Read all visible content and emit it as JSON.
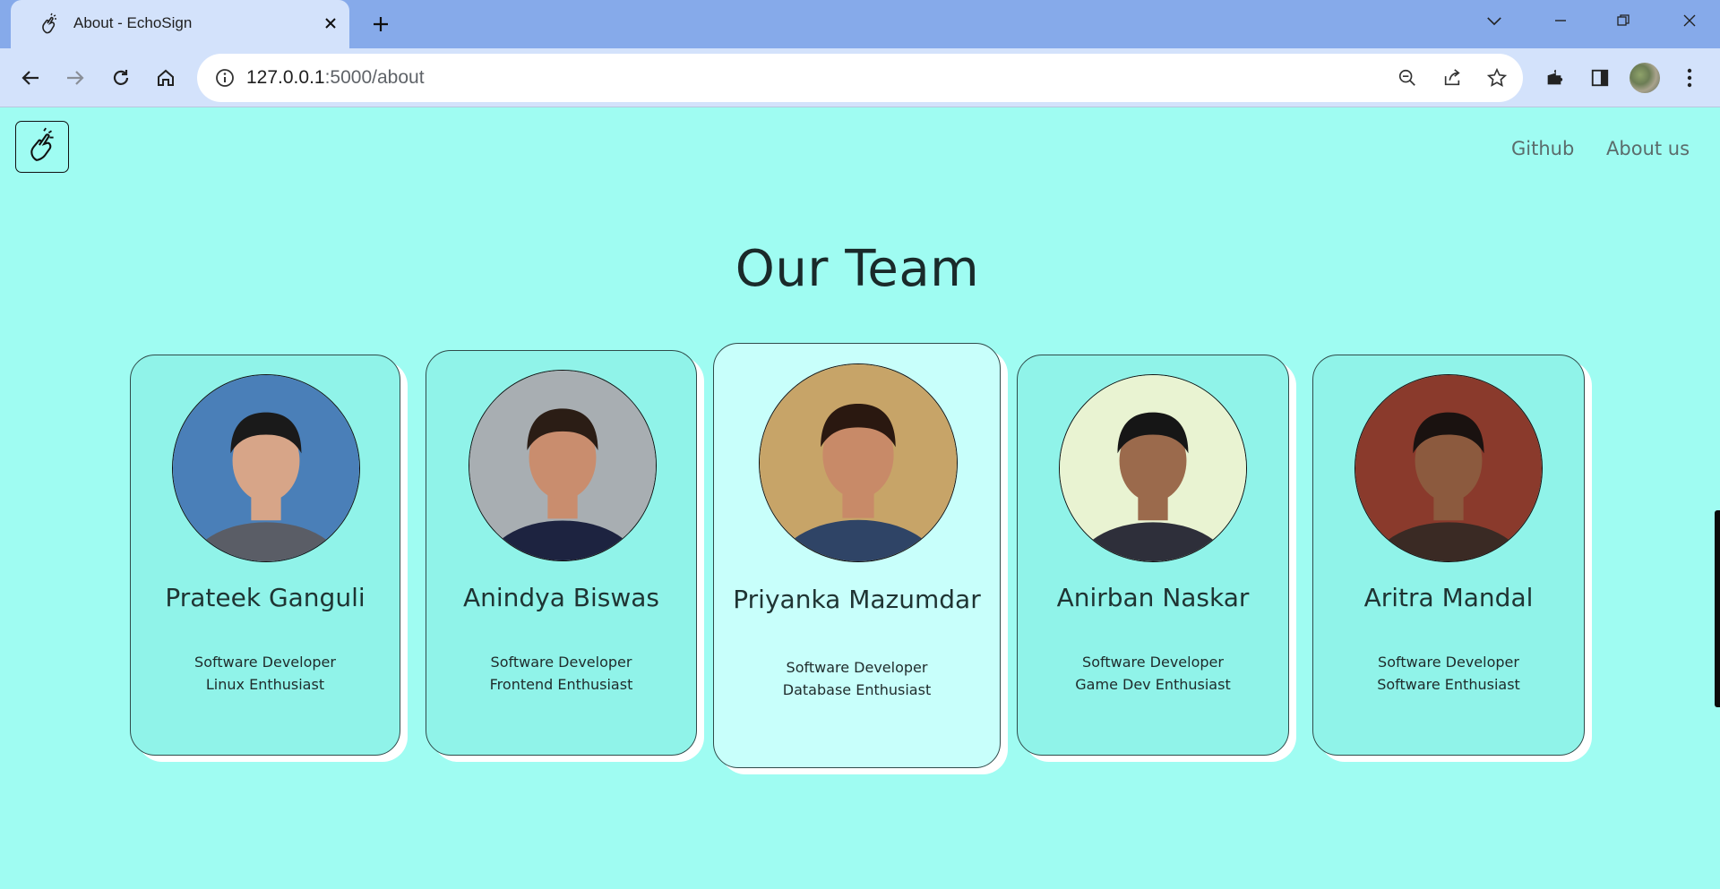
{
  "browser": {
    "tab_title": "About - EchoSign",
    "url_host": "127.0.0.1",
    "url_path": ":5000/about"
  },
  "nav": {
    "links": [
      {
        "label": "Github"
      },
      {
        "label": "About us"
      }
    ]
  },
  "page": {
    "title": "Our Team"
  },
  "team": [
    {
      "name": "Prateek Ganguli",
      "role_line1": "Software Developer",
      "role_line2": "Linux Enthusiast",
      "bg": "#4a7fb8",
      "skin": "#d7a588",
      "hair": "#1a1a1a",
      "shirt": "#5a5d66"
    },
    {
      "name": "Anindya Biswas",
      "role_line1": "Software Developer",
      "role_line2": "Frontend Enthusiast",
      "bg": "#a8aeb2",
      "skin": "#c98d6e",
      "hair": "#2b1d15",
      "shirt": "#1d2340"
    },
    {
      "name": "Priyanka Mazumdar",
      "role_line1": "Software Developer",
      "role_line2": "Database Enthusiast",
      "bg": "#c7a468",
      "skin": "#c88a68",
      "hair": "#2a1810",
      "shirt": "#2f4466"
    },
    {
      "name": "Anirban Naskar",
      "role_line1": "Software Developer",
      "role_line2": "Game Dev Enthusiast",
      "bg": "#e9f3d2",
      "skin": "#9b6a4c",
      "hair": "#161616",
      "shirt": "#2e2f3a"
    },
    {
      "name": "Aritra Mandal",
      "role_line1": "Software Developer",
      "role_line2": "Software Enthusiast",
      "bg": "#8a3a2c",
      "skin": "#8c5a3e",
      "hair": "#1a1210",
      "shirt": "#3a2a24"
    }
  ],
  "colors": {
    "page_bg": "#9ffcf2",
    "card_bg": "#90f3e9",
    "featured_card_bg": "#c8fffb"
  }
}
